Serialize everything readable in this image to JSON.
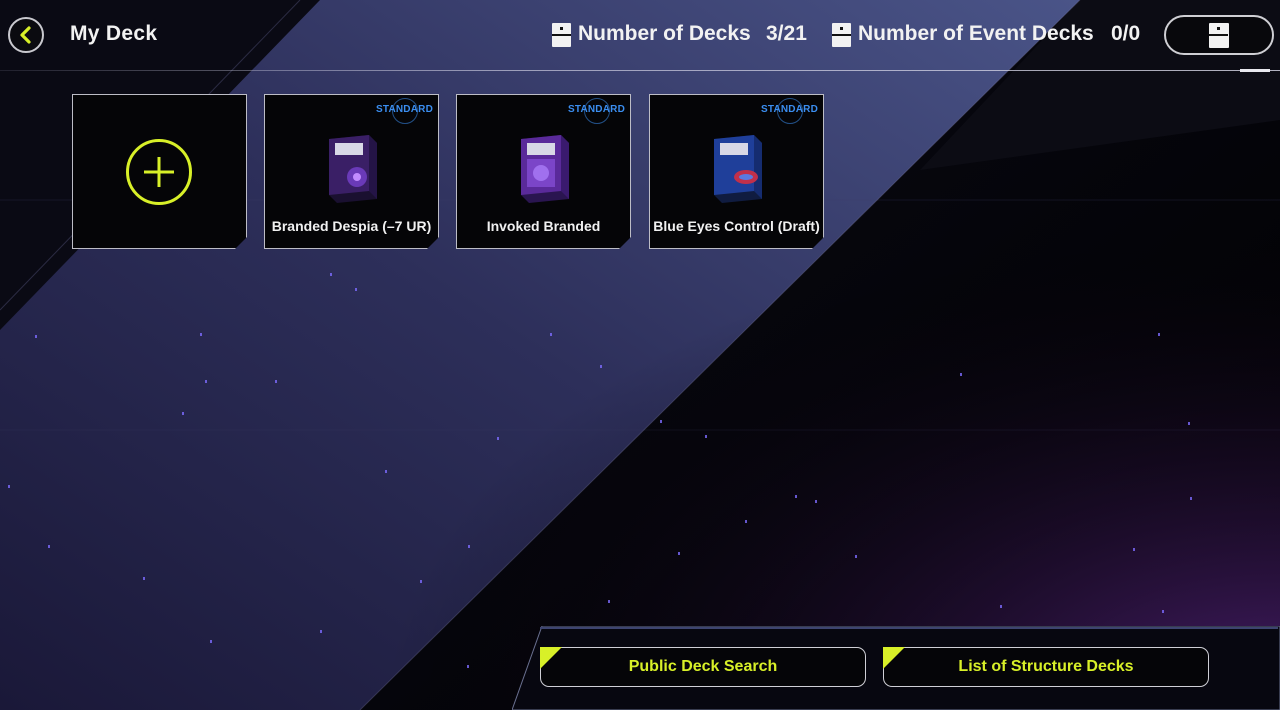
{
  "header": {
    "title": "My Deck",
    "decks_label": "Number of Decks",
    "decks_count": "3/21",
    "event_decks_label": "Number of Event Decks",
    "event_decks_count": "0/0"
  },
  "decks": [
    {
      "name": "Branded Despia (–7 UR)",
      "format": "STANDARD",
      "box_color": "#3a1f66"
    },
    {
      "name": "Invoked Branded",
      "format": "STANDARD",
      "box_color": "#5a2a9a"
    },
    {
      "name": "Blue Eyes Control (Draft)",
      "format": "STANDARD",
      "box_color": "#1f3f9a"
    }
  ],
  "buttons": {
    "public_search": "Public Deck Search",
    "structure_decks": "List of Structure Decks"
  },
  "colors": {
    "accent": "#d8f028",
    "badge": "#3b8ef0"
  }
}
